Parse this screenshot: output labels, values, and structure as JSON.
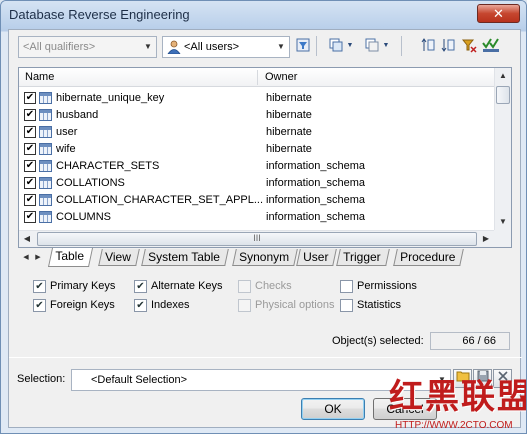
{
  "window": {
    "title": "Database Reverse Engineering",
    "close_glyph": "✕"
  },
  "toolbar": {
    "qualifier_combo": {
      "value": "<All qualifiers>",
      "disabled": true
    },
    "user_combo": {
      "value": "<All users>",
      "icon": "user-icon"
    },
    "icons": [
      "filter-funnel-icon",
      "select-all-icon",
      "deselect-icon",
      "dropdown-arrow-icon",
      "move-up-icon",
      "move-down-icon",
      "filter-icon",
      "check-all-icon"
    ]
  },
  "list": {
    "columns": [
      "Name",
      "Owner"
    ],
    "rows": [
      {
        "checked": true,
        "name": "hibernate_unique_key",
        "owner": "hibernate"
      },
      {
        "checked": true,
        "name": "husband",
        "owner": "hibernate"
      },
      {
        "checked": true,
        "name": "user",
        "owner": "hibernate"
      },
      {
        "checked": true,
        "name": "wife",
        "owner": "hibernate"
      },
      {
        "checked": true,
        "name": "CHARACTER_SETS",
        "owner": "information_schema"
      },
      {
        "checked": true,
        "name": "COLLATIONS",
        "owner": "information_schema"
      },
      {
        "checked": true,
        "name": "COLLATION_CHARACTER_SET_APPL...",
        "owner": "information_schema"
      },
      {
        "checked": true,
        "name": "COLUMNS",
        "owner": "information_schema"
      }
    ],
    "hscroll_grip": "III"
  },
  "tabs": {
    "items": [
      "Table",
      "View",
      "System Table",
      "Synonym",
      "User",
      "Trigger",
      "Procedure"
    ],
    "active": "Table"
  },
  "options": [
    {
      "label": "Primary Keys",
      "checked": true,
      "enabled": true
    },
    {
      "label": "Alternate Keys",
      "checked": true,
      "enabled": true
    },
    {
      "label": "Checks",
      "checked": false,
      "enabled": false
    },
    {
      "label": "Permissions",
      "checked": false,
      "enabled": true
    },
    {
      "label": "Foreign Keys",
      "checked": true,
      "enabled": true
    },
    {
      "label": "Indexes",
      "checked": true,
      "enabled": true
    },
    {
      "label": "Physical options",
      "checked": false,
      "enabled": false
    },
    {
      "label": "Statistics",
      "checked": false,
      "enabled": true
    }
  ],
  "status": {
    "selected_label": "Object(s) selected:",
    "selected_count": "66 / 66"
  },
  "selection": {
    "label": "Selection:",
    "value": "<Default Selection>"
  },
  "buttons": {
    "ok": "OK",
    "cancel": "Cancel"
  },
  "watermark": {
    "text": "红黑联盟",
    "url": "HTTP://WWW.2CTO.COM"
  },
  "colors": {
    "title_bar": "#c6d8ee",
    "close_button": "#c6462f",
    "watermark": "#c01c1c"
  }
}
